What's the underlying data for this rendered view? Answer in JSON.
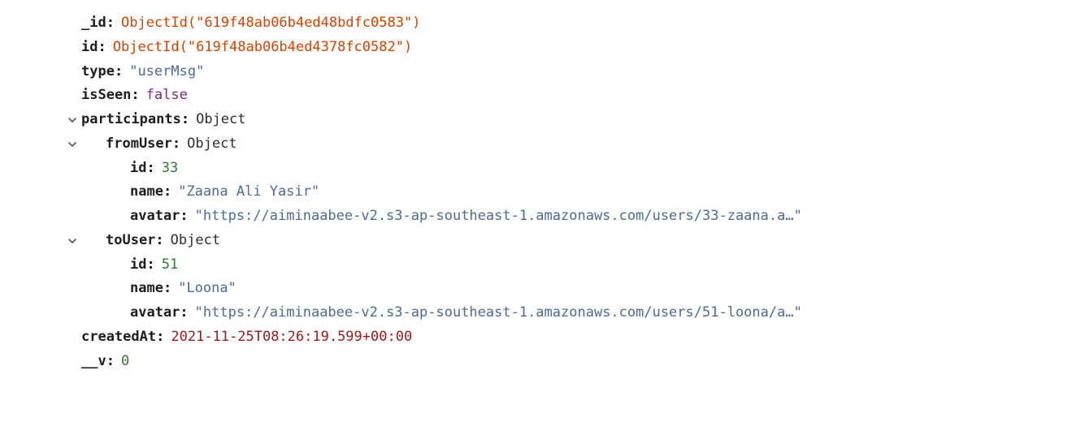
{
  "doc": {
    "_id_key": "_id",
    "_id_val": "ObjectId(\"619f48ab06b4ed48bdfc0583\")",
    "id_key": "id",
    "id_val": "ObjectId(\"619f48ab06b4ed4378fc0582\")",
    "type_key": "type",
    "type_val": "\"userMsg\"",
    "isSeen_key": "isSeen",
    "isSeen_val": "false",
    "participants_key": "participants",
    "participants_val": "Object",
    "fromUser_key": "fromUser",
    "fromUser_val": "Object",
    "fromUser_id_key": "id",
    "fromUser_id_val": "33",
    "fromUser_name_key": "name",
    "fromUser_name_val": "\"Zaana Ali Yasir\"",
    "fromUser_avatar_key": "avatar",
    "fromUser_avatar_val": "\"https://aiminaabee-v2.s3-ap-southeast-1.amazonaws.com/users/33-zaana.a…\"",
    "toUser_key": "toUser",
    "toUser_val": "Object",
    "toUser_id_key": "id",
    "toUser_id_val": "51",
    "toUser_name_key": "name",
    "toUser_name_val": "\"Loona\"",
    "toUser_avatar_key": "avatar",
    "toUser_avatar_val": "\"https://aiminaabee-v2.s3-ap-southeast-1.amazonaws.com/users/51-loona/a…\"",
    "createdAt_key": "createdAt",
    "createdAt_val": "2021-11-25T08:26:19.599+00:00",
    "__v_key": "__v",
    "__v_val": "0"
  }
}
